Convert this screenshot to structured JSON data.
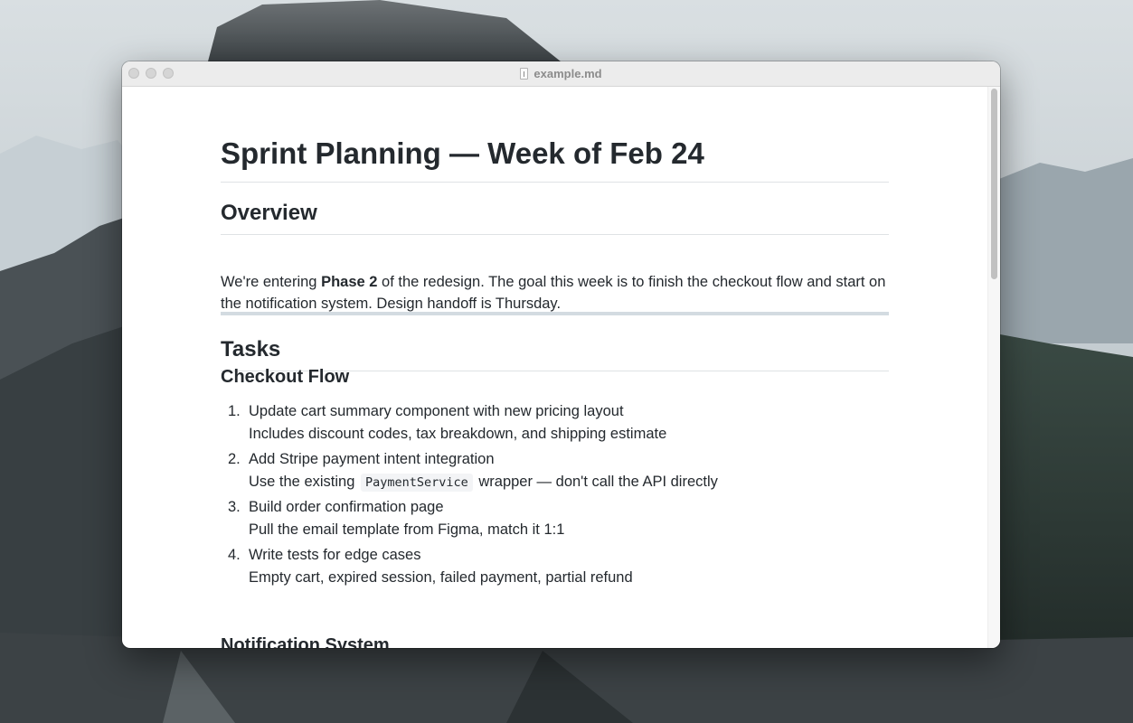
{
  "window": {
    "title": "example.md",
    "file_icon": "document-icon",
    "controls": [
      "close",
      "minimize",
      "zoom"
    ]
  },
  "document": {
    "h1": "Sprint Planning — Week of Feb 24",
    "overview": {
      "heading": "Overview",
      "text_before": "We're entering ",
      "bold": "Phase 2",
      "text_after": " of the redesign. The goal this week is to finish the checkout flow and start on the notification system. Design handoff is Thursday."
    },
    "tasks": {
      "heading": "Tasks",
      "checkout": {
        "heading": "Checkout Flow",
        "items": [
          {
            "number": "1.",
            "title": "Update cart summary component with new pricing layout",
            "detail": "Includes discount codes, tax breakdown, and shipping estimate"
          },
          {
            "number": "2.",
            "title": "Add Stripe payment intent integration",
            "detail_before": "Use the existing ",
            "detail_code": "PaymentService",
            "detail_after": " wrapper — don't call the API directly"
          },
          {
            "number": "3.",
            "title": "Build order confirmation page",
            "detail": "Pull the email template from Figma, match it 1:1"
          },
          {
            "number": "4.",
            "title": "Write tests for edge cases",
            "detail": "Empty cart, expired session, failed payment, partial refund"
          }
        ]
      },
      "notification": {
        "heading": "Notification System"
      }
    }
  },
  "colors": {
    "text": "#24292e",
    "rule": "#dfe2e5",
    "hr": "#d3dbe1",
    "titlebar": "#ececec"
  }
}
